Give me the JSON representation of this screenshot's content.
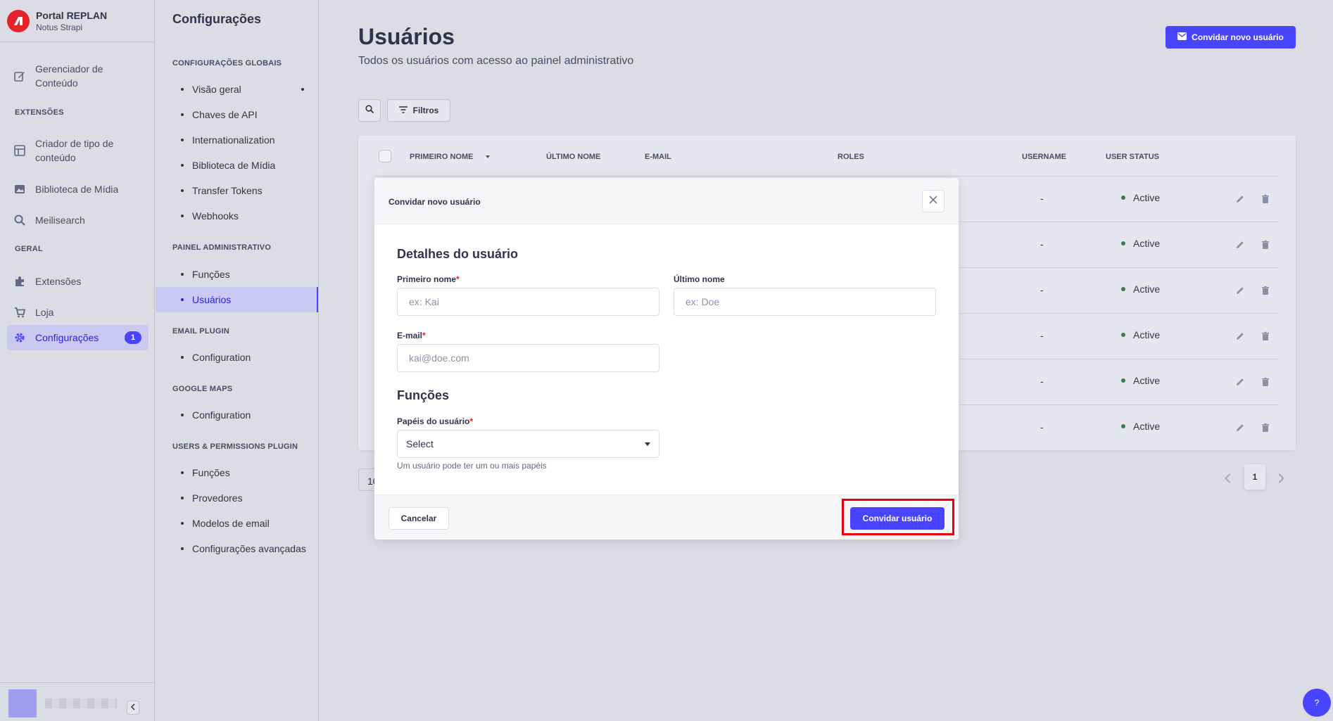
{
  "brand": {
    "title": "Portal REPLAN",
    "subtitle": "Notus Strapi"
  },
  "mainnav": {
    "content_manager": "Gerenciador de Conteúdo",
    "section_extensions": "EXTENSÕES",
    "content_type_builder": "Criador de tipo de conteúdo",
    "media_library": "Biblioteca de Mídia",
    "meilisearch": "Meilisearch",
    "section_general": "GERAL",
    "plugins": "Extensões",
    "marketplace": "Loja",
    "settings": "Configurações",
    "settings_badge": "1"
  },
  "subnav": {
    "title": "Configurações",
    "global_section": "CONFIGURAÇÕES GLOBAIS",
    "global_items": [
      "Visão geral",
      "Chaves de API",
      "Internationalization",
      "Biblioteca de Mídia",
      "Transfer Tokens",
      "Webhooks"
    ],
    "admin_section": "PAINEL ADMINISTRATIVO",
    "admin_items": [
      "Funções",
      "Usuários"
    ],
    "email_section": "EMAIL PLUGIN",
    "email_items": [
      "Configuration"
    ],
    "maps_section": "GOOGLE MAPS",
    "maps_items": [
      "Configuration"
    ],
    "up_section": "USERS & PERMISSIONS PLUGIN",
    "up_items": [
      "Funções",
      "Provedores",
      "Modelos de email",
      "Configurações avançadas"
    ]
  },
  "header": {
    "title": "Usuários",
    "subtitle": "Todos os usuários com acesso ao painel administrativo",
    "invite_button": "Convidar novo usuário"
  },
  "toolbar": {
    "filters": "Filtros"
  },
  "table": {
    "columns": [
      "PRIMEIRO NOME",
      "ÚLTIMO NOME",
      "E-MAIL",
      "ROLES",
      "USERNAME",
      "USER STATUS"
    ],
    "rows": [
      {
        "username": "-",
        "status": "Active"
      },
      {
        "username": "-",
        "status": "Active"
      },
      {
        "username": "-",
        "status": "Active"
      },
      {
        "username": "-",
        "status": "Active"
      },
      {
        "username": "-",
        "status": "Active"
      },
      {
        "username": "-",
        "status": "Active"
      }
    ]
  },
  "pagination": {
    "page_size": "10",
    "current_page": "1"
  },
  "help": {
    "label": "?"
  },
  "modal": {
    "title": "Convidar novo usuário",
    "details_heading": "Detalhes do usuário",
    "first_name_label": "Primeiro nome",
    "first_name_placeholder": "ex: Kai",
    "last_name_label": "Último nome",
    "last_name_placeholder": "ex: Doe",
    "email_label": "E-mail",
    "email_placeholder": "kai@doe.com",
    "roles_heading": "Funções",
    "roles_label": "Papéis do usuário",
    "roles_select": "Select",
    "roles_hint": "Um usuário pode ter um ou mais papéis",
    "cancel": "Cancelar",
    "submit": "Convidar usuário",
    "required_mark": "*"
  },
  "colors": {
    "primary": "#4945ff",
    "danger": "#d02b20",
    "success": "#328048",
    "highlight": "#e8000b"
  }
}
